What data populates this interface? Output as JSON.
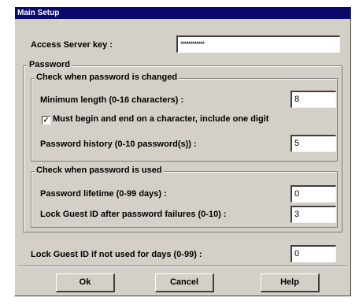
{
  "window": {
    "title": "Main Setup"
  },
  "access_server_key": {
    "label": "Access Server key :",
    "value": "************"
  },
  "password_group": {
    "title": "Password",
    "changed_group": {
      "title": "Check when password is changed",
      "min_length": {
        "label": "Minimum length (0-16 characters) :",
        "value": "8"
      },
      "must_begin": {
        "label": "Must begin and end on a character, include one digit",
        "checked": true
      },
      "history": {
        "label": "Password history (0-10 password(s)) :",
        "value": "5"
      }
    },
    "used_group": {
      "title": "Check when password is used",
      "lifetime": {
        "label": "Password lifetime (0-99 days) :",
        "value": "0"
      },
      "lock_failures": {
        "label": "Lock Guest ID after password failures (0-10) :",
        "value": "3"
      }
    }
  },
  "lock_unused": {
    "label": "Lock Guest ID if not used for days (0-99) :",
    "value": "0"
  },
  "buttons": {
    "ok": "Ok",
    "cancel": "Cancel",
    "help": "Help"
  }
}
